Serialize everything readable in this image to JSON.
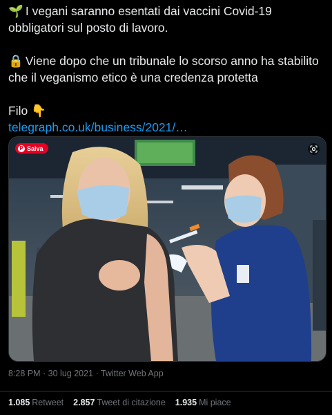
{
  "tweet": {
    "line1_emoji": "🌱",
    "line1_text": "I vegani saranno esentati dai vaccini Covid-19 obbligatori sul posto di lavoro.",
    "line2_emoji": "🔒",
    "line2_text": "Viene dopo che un tribunale lo scorso anno ha stabilito che il veganismo etico è una credenza protetta",
    "line3_text": "Filo",
    "line3_emoji": "👇",
    "link_text": "telegraph.co.uk/business/2021/…"
  },
  "media": {
    "save_label": "Salva",
    "save_icon": "pinterest-icon",
    "lens_icon": "google-lens-icon"
  },
  "meta": {
    "timestamp": "8:28 PM · 30 lug 2021 · Twitter Web App"
  },
  "stats": {
    "retweets_count": "1.085",
    "retweets_label": "Retweet",
    "quotes_count": "2.857",
    "quotes_label": "Tweet di citazione",
    "likes_count": "1.935",
    "likes_label": "Mi piace"
  },
  "colors": {
    "background": "#000000",
    "text": "#e7e9ea",
    "link": "#1d9bf0",
    "muted": "#71767b",
    "save_red": "#e60023"
  }
}
